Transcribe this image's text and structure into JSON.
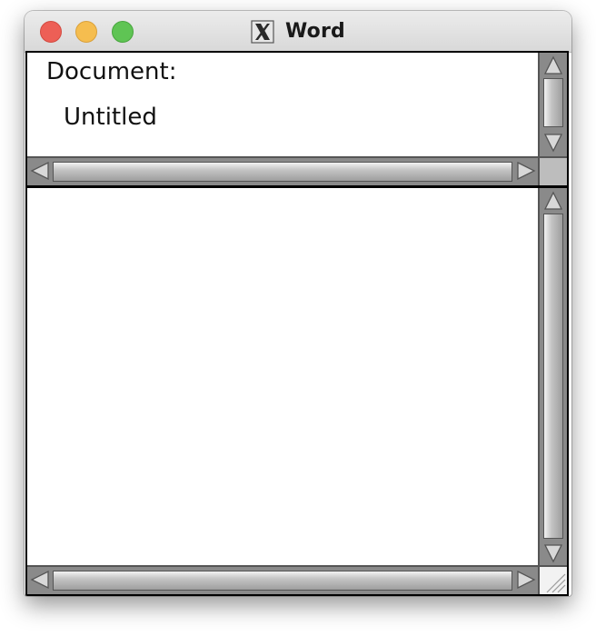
{
  "window": {
    "title": "Word",
    "app_icon": "x11-icon",
    "controls": [
      "close",
      "minimize",
      "maximize"
    ]
  },
  "top_pane": {
    "document_label": "Document:",
    "document_name": "Untitled"
  },
  "bottom_pane": {
    "text": ""
  },
  "icons": {
    "scroll_up": "arrow-up-icon",
    "scroll_down": "arrow-down-icon",
    "scroll_left": "arrow-left-icon",
    "scroll_right": "arrow-right-icon",
    "resize": "resize-grip-icon"
  },
  "colors": {
    "close": "#ed5f56",
    "minimize": "#f5bd4f",
    "maximize": "#5fc454",
    "scrollbar_track": "#8a8a8a",
    "scrollbar_thumb": "#c4c4c4"
  }
}
